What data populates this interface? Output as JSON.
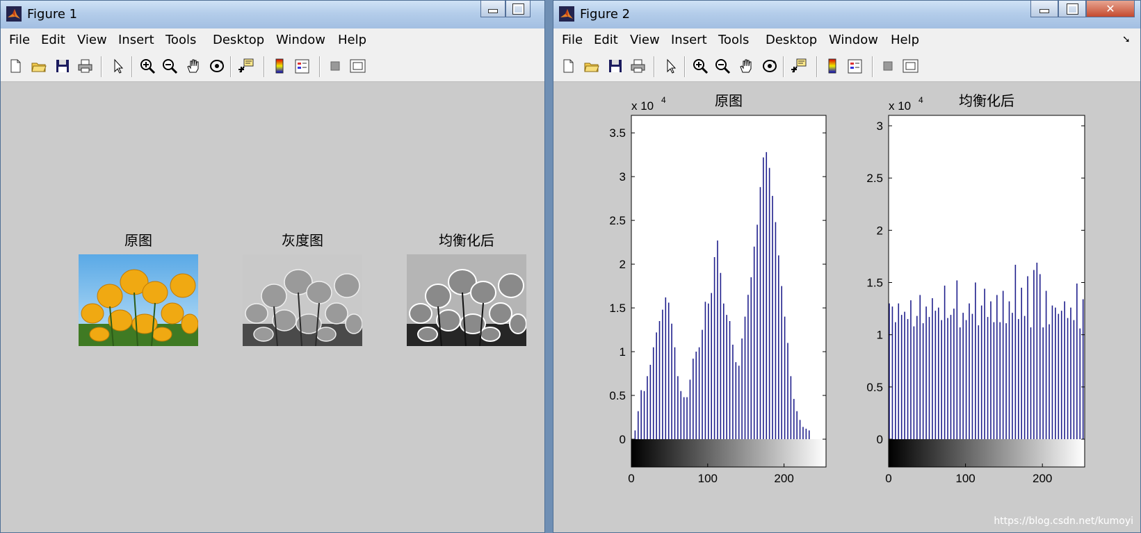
{
  "figure1": {
    "title": "Figure 1",
    "menu": [
      "File",
      "Edit",
      "View",
      "Insert",
      "Tools",
      "Desktop",
      "Window",
      "Help"
    ],
    "subplots": [
      {
        "title": "原图",
        "image": "color-tulips"
      },
      {
        "title": "灰度图",
        "image": "grayscale-tulips"
      },
      {
        "title": "均衡化后",
        "image": "equalized-grayscale-tulips"
      }
    ]
  },
  "figure2": {
    "title": "Figure 2",
    "menu": [
      "File",
      "Edit",
      "View",
      "Insert",
      "Tools",
      "Desktop",
      "Window",
      "Help"
    ],
    "watermark": "https://blog.csdn.net/kumoyi"
  },
  "toolbar_icons": [
    "new-file-icon",
    "open-folder-icon",
    "save-icon",
    "print-icon",
    "pointer-arrow-icon",
    "zoom-in-icon",
    "zoom-out-icon",
    "pan-hand-icon",
    "rotate-3d-icon",
    "data-cursor-icon",
    "colorbar-icon",
    "legend-icon",
    "hide-plot-tools-icon",
    "show-plot-tools-icon"
  ],
  "colors": {
    "bar": "#1f1f8c",
    "window_bg": "#cbcbcb",
    "axes_bg": "#ffffff"
  },
  "chart_data": [
    {
      "type": "bar",
      "title": "原图",
      "exponent_label": "x 10",
      "exponent": "4",
      "xlim": [
        0,
        255
      ],
      "ylim": [
        0,
        3.7
      ],
      "xticks": [
        "0",
        "100",
        "200"
      ],
      "yticks": [
        "0",
        "0.5",
        "1",
        "1.5",
        "2",
        "2.5",
        "3",
        "3.5"
      ],
      "colorbar": "gray-gradient",
      "x": [
        0,
        4,
        8,
        12,
        16,
        20,
        24,
        28,
        32,
        36,
        40,
        44,
        48,
        52,
        56,
        60,
        64,
        68,
        72,
        76,
        80,
        84,
        88,
        92,
        96,
        100,
        104,
        108,
        112,
        116,
        120,
        124,
        128,
        132,
        136,
        140,
        144,
        148,
        152,
        156,
        160,
        164,
        168,
        172,
        176,
        180,
        184,
        188,
        192,
        196,
        200,
        204,
        208,
        212,
        216,
        220,
        224,
        228,
        232,
        236,
        240,
        244,
        248,
        252
      ],
      "values": [
        0.0,
        0.1,
        0.32,
        0.56,
        0.55,
        0.72,
        0.85,
        1.05,
        1.22,
        1.35,
        1.48,
        1.62,
        1.56,
        1.32,
        1.05,
        0.72,
        0.55,
        0.48,
        0.48,
        0.68,
        0.92,
        1.0,
        1.05,
        1.25,
        1.57,
        1.55,
        1.67,
        2.08,
        2.27,
        1.9,
        1.55,
        1.42,
        1.35,
        1.08,
        0.88,
        0.84,
        1.15,
        1.4,
        1.65,
        1.85,
        2.2,
        2.45,
        2.88,
        3.22,
        3.28,
        3.1,
        2.78,
        2.48,
        2.1,
        1.75,
        1.4,
        1.1,
        0.72,
        0.46,
        0.32,
        0.22,
        0.14,
        0.12,
        0.1
      ]
    },
    {
      "type": "bar",
      "title": "均衡化后",
      "exponent_label": "x 10",
      "exponent": "4",
      "xlim": [
        0,
        255
      ],
      "ylim": [
        0,
        3.1
      ],
      "xticks": [
        "0",
        "100",
        "200"
      ],
      "yticks": [
        "0",
        "0.5",
        "1",
        "1.5",
        "2",
        "2.5",
        "3"
      ],
      "colorbar": "gray-gradient",
      "x": [
        0,
        4,
        8,
        12,
        16,
        20,
        24,
        28,
        32,
        36,
        40,
        44,
        48,
        52,
        56,
        60,
        64,
        68,
        72,
        76,
        80,
        84,
        88,
        92,
        96,
        100,
        104,
        108,
        112,
        116,
        120,
        124,
        128,
        132,
        136,
        140,
        144,
        148,
        152,
        156,
        160,
        164,
        168,
        172,
        176,
        180,
        184,
        188,
        192,
        196,
        200,
        204,
        208,
        212,
        216,
        220,
        224,
        228,
        232,
        236,
        240,
        244,
        248,
        252
      ],
      "values": [
        1.3,
        1.27,
        1.12,
        1.3,
        1.19,
        1.22,
        1.15,
        1.33,
        1.08,
        1.18,
        1.38,
        1.11,
        1.27,
        1.17,
        1.35,
        1.23,
        1.26,
        1.14,
        1.47,
        1.16,
        1.19,
        1.25,
        1.52,
        1.07,
        1.21,
        1.14,
        1.3,
        1.2,
        1.5,
        1.09,
        1.28,
        1.44,
        1.17,
        1.32,
        1.12,
        1.38,
        1.12,
        1.42,
        1.11,
        1.32,
        1.21,
        1.67,
        1.15,
        1.45,
        1.18,
        1.56,
        1.07,
        1.62,
        1.69,
        1.58,
        1.07,
        1.42,
        1.1,
        1.28,
        1.26,
        1.2,
        1.23,
        1.32,
        1.16,
        1.26,
        1.14,
        1.49,
        1.06,
        1.34
      ]
    }
  ]
}
